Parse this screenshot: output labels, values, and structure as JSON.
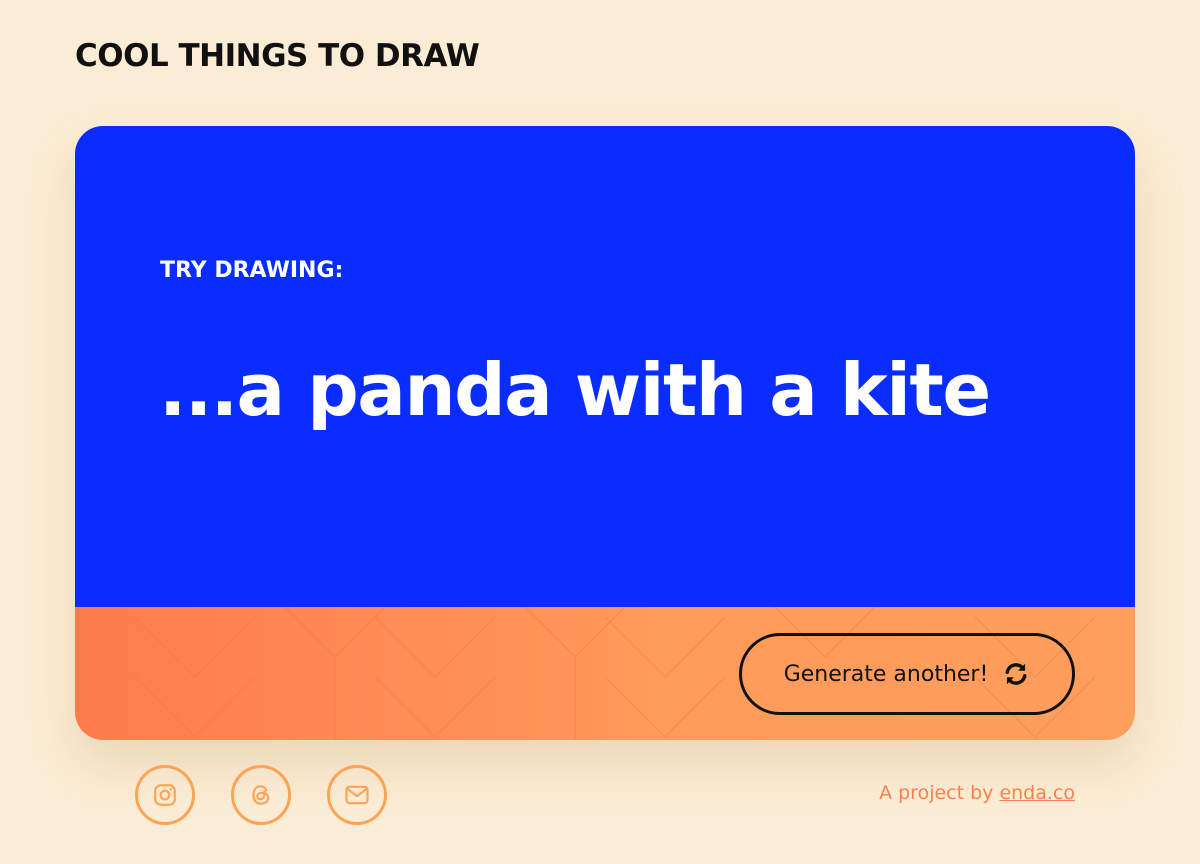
{
  "site": {
    "title": "COOL THINGS TO DRAW"
  },
  "card": {
    "eyebrow": "TRY DRAWING:",
    "prompt": "...a panda with a kite",
    "generate_label": "Generate another!"
  },
  "footer": {
    "socials": [
      {
        "icon": "instagram-icon"
      },
      {
        "icon": "threads-icon"
      },
      {
        "icon": "mail-icon"
      }
    ],
    "credit_prefix": "A project by",
    "credit_link": "enda.co"
  },
  "colors": {
    "background": "#fbedd5",
    "card_blue": "#0a2cff",
    "card_orange_start": "#ff7b4c",
    "card_orange_end": "#ff9f5d",
    "accent_orange": "#ffa357",
    "link": "#ff7f50"
  }
}
